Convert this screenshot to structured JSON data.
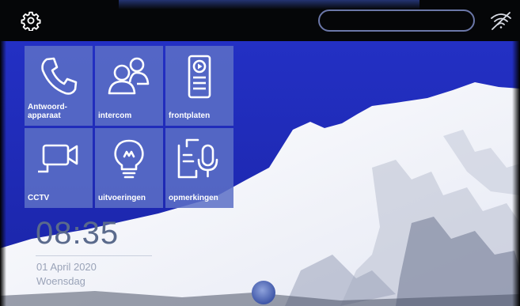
{
  "topbar": {
    "settings_icon": "gear-icon",
    "status_pill": "",
    "wifi_icon": "wifi-off-icon"
  },
  "tiles": [
    {
      "label": "Antwoord-\napparaat",
      "icon": "phone-handset-icon"
    },
    {
      "label": "intercom",
      "icon": "two-users-icon"
    },
    {
      "label": "frontplaten",
      "icon": "door-panel-icon"
    },
    {
      "label": "CCTV",
      "icon": "video-camera-icon"
    },
    {
      "label": "uitvoeringen",
      "icon": "lightbulb-icon"
    },
    {
      "label": "opmerkingen",
      "icon": "voice-memo-icon"
    }
  ],
  "clock": {
    "time": "08:35",
    "date": "01 April 2020",
    "day": "Woensdag"
  },
  "colors": {
    "sky": "#1e2ab8",
    "tile": "#5c70c6",
    "topbar": "#050608",
    "clock_text": "#5a6a8c"
  }
}
